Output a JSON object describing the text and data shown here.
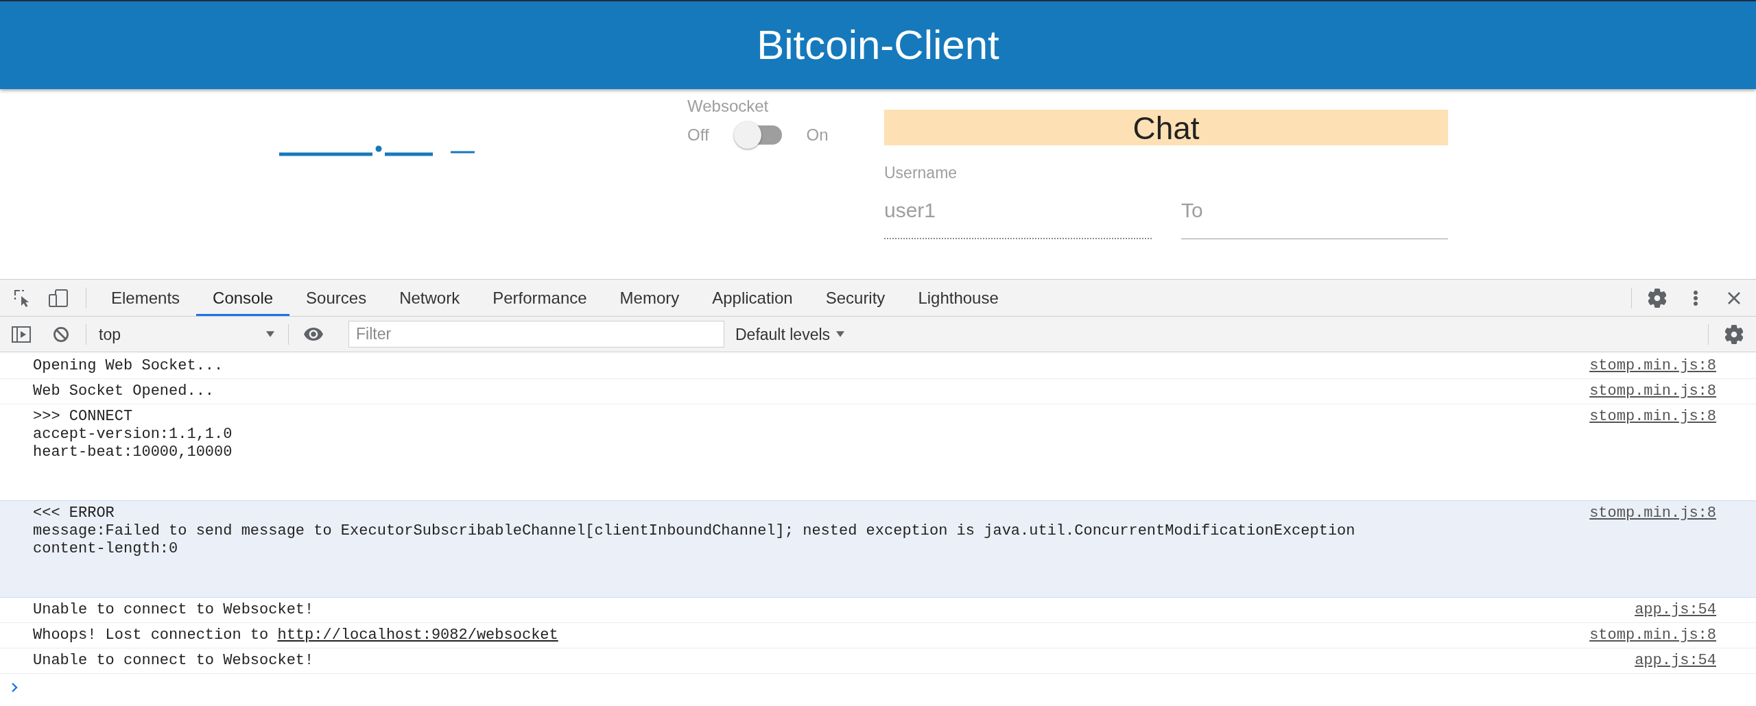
{
  "header": {
    "title": "Bitcoin-Client"
  },
  "websocket": {
    "label": "Websocket",
    "off_label": "Off",
    "on_label": "On",
    "on": false
  },
  "chat": {
    "title": "Chat",
    "username": {
      "label": "Username",
      "value": "user1",
      "disabled": true
    },
    "recipient": {
      "placeholder": "To"
    }
  },
  "devtools": {
    "tabs": [
      {
        "label": "Elements",
        "selected": false
      },
      {
        "label": "Console",
        "selected": true
      },
      {
        "label": "Sources",
        "selected": false
      },
      {
        "label": "Network",
        "selected": false
      },
      {
        "label": "Performance",
        "selected": false
      },
      {
        "label": "Memory",
        "selected": false
      },
      {
        "label": "Application",
        "selected": false
      },
      {
        "label": "Security",
        "selected": false
      },
      {
        "label": "Lighthouse",
        "selected": false
      }
    ],
    "context": "top",
    "filter": {
      "placeholder": "Filter"
    },
    "levels": "Default levels"
  },
  "console": {
    "messages": [
      {
        "lines": [
          "Opening Web Socket..."
        ],
        "source": "stomp.min.js:8",
        "highlighted": false
      },
      {
        "lines": [
          "Web Socket Opened..."
        ],
        "source": "stomp.min.js:8",
        "highlighted": false
      },
      {
        "lines": [
          ">>> CONNECT",
          "accept-version:1.1,1.0",
          "heart-beat:10000,10000"
        ],
        "source": "stomp.min.js:8",
        "highlighted": false
      },
      {
        "lines": [
          "<<< ERROR",
          "message:Failed to send message to ExecutorSubscribableChannel[clientInboundChannel]; nested exception is java.util.ConcurrentModificationException",
          "content-length:0"
        ],
        "source": "stomp.min.js:8",
        "highlighted": true
      },
      {
        "lines": [
          "Unable to connect to Websocket!"
        ],
        "source": "app.js:54",
        "highlighted": false
      },
      {
        "lines": [
          "Whoops! Lost connection to "
        ],
        "link": "http://localhost:9082/websocket",
        "source": "stomp.min.js:8",
        "highlighted": false
      },
      {
        "lines": [
          "Unable to connect to Websocket!"
        ],
        "source": "app.js:54",
        "highlighted": false
      }
    ]
  }
}
